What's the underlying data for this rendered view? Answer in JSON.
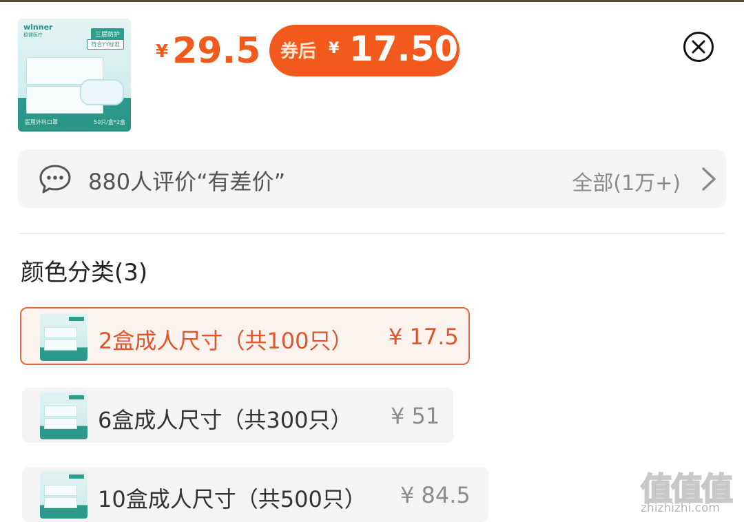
{
  "product": {
    "thumb": {
      "brand": "winner",
      "brand_sub": "稳健医疗",
      "tag1": "三层防护",
      "tag2": "符合YY标准",
      "foot_left": "医用外科口罩",
      "foot_right": "50只/盒*2盒"
    },
    "price_currency": "¥",
    "price": "29.5",
    "coupon_label": "券后",
    "coupon_currency": "¥",
    "coupon_price": "17.50"
  },
  "reviews": {
    "icon": "chat-bubble-icon",
    "summary": "880人评价“有差价”",
    "all_label": "全部(1万+)"
  },
  "options_section": {
    "title": "颜色分类(3)",
    "items": [
      {
        "name": "2盒成人尺寸（共100只）",
        "price": "¥ 17.5",
        "selected": true
      },
      {
        "name": "6盒成人尺寸（共300只）",
        "price": "¥ 51",
        "selected": false
      },
      {
        "name": "10盒成人尺寸（共500只）",
        "price": "¥ 84.5",
        "selected": false
      }
    ]
  },
  "watermark": {
    "logo": "值值值",
    "site": "zhizhizhi.com"
  },
  "colors": {
    "accent": "#f05a1c",
    "selected_border": "#e46a3c",
    "bar_bg": "#f4f4f4"
  }
}
